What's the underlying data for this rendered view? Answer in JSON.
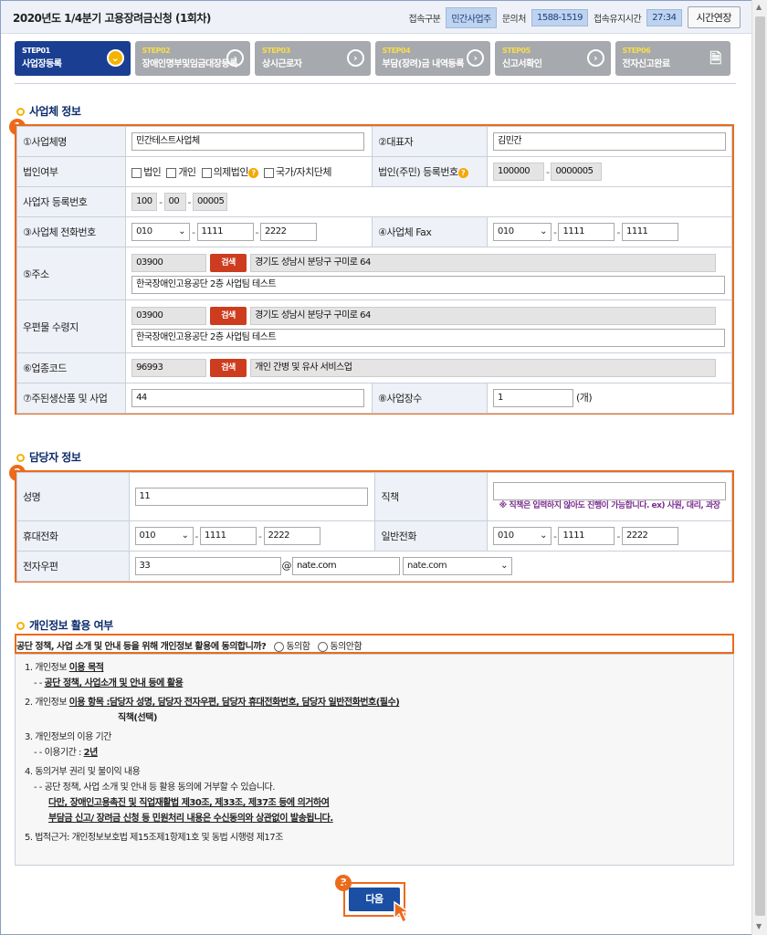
{
  "header": {
    "title": "2020년도 1/4분기 고용장려금신청 (1회차)",
    "conn_type_label": "접속구분",
    "conn_type_value": "민간사업주",
    "inquiry_label": "문의처",
    "inquiry_value": "1588-1519",
    "session_label": "접속유지시간",
    "session_value": "27:34",
    "extend_button": "시간연장"
  },
  "steps": [
    {
      "num": "STEP01",
      "label": "사업장등록",
      "active": true
    },
    {
      "num": "STEP02",
      "label": "장애인명부및임금대장등록",
      "active": false
    },
    {
      "num": "STEP03",
      "label": "상시근로자",
      "active": false
    },
    {
      "num": "STEP04",
      "label": "부담(장려)금 내역등록",
      "active": false
    },
    {
      "num": "STEP05",
      "label": "신고서확인",
      "active": false
    },
    {
      "num": "STEP06",
      "label": "전자신고완료",
      "active": false
    }
  ],
  "section1": {
    "title": "사업체 정보",
    "badge": "1",
    "company_name_label": "①사업체명",
    "company_name_value": "민간테스트사업체",
    "ceo_label": "②대표자",
    "ceo_value": "김민간",
    "corp_label": "법인여부",
    "corp_options": [
      "법인",
      "개인",
      "의제법인",
      "국가/자치단체"
    ],
    "corp_reg_label": "법인(주민) 등록번호",
    "corp_reg_1": "100000",
    "corp_reg_2": "0000005",
    "biz_no_label": "사업자 등록번호",
    "biz_no_1": "100",
    "biz_no_2": "00",
    "biz_no_3": "00005",
    "phone_label": "③사업체 전화번호",
    "phone_1": "010",
    "phone_2": "1111",
    "phone_3": "2222",
    "fax_label": "④사업체 Fax",
    "fax_1": "010",
    "fax_2": "1111",
    "fax_3": "1111",
    "addr_label": "⑤주소",
    "addr_zip": "03900",
    "addr_main": "경기도 성남시 분당구 구미로 64",
    "addr_detail": "한국장애인고용공단 2층 사업팀 테스트",
    "mail_addr_label": "우편물 수령지",
    "mail_zip": "03900",
    "mail_main": "경기도 성남시 분당구 구미로 64",
    "mail_detail": "한국장애인고용공단 2층 사업팀 테스트",
    "industry_label": "⑥업종코드",
    "industry_code": "96993",
    "industry_name": "개인 간병 및 유사 서비스업",
    "product_label": "⑦주된생산품 및 사업",
    "product_value": "44",
    "sites_label": "⑧사업장수",
    "sites_value": "1",
    "sites_unit": "(개)",
    "search_button": "검색"
  },
  "section2": {
    "title": "담당자 정보",
    "badge": "2",
    "name_label": "성명",
    "name_value": "11",
    "position_label": "직책",
    "position_value": "",
    "position_note": "※ 직책은 입력하지 않아도 진행이 가능합니다. ex) 사원, 대리, 과장",
    "mobile_label": "휴대전화",
    "mobile_1": "010",
    "mobile_2": "1111",
    "mobile_3": "2222",
    "tel_label": "일반전화",
    "tel_1": "010",
    "tel_2": "1111",
    "tel_3": "2222",
    "email_label": "전자우편",
    "email_id": "33",
    "email_at": "@",
    "email_domain": "nate.com",
    "email_domain_select": "nate.com"
  },
  "section3": {
    "title": "개인정보 활용 여부",
    "question": "공단 정책, 사업 소개 및 안내 등을 위해 개인정보 활용에 동의합니까?",
    "agree": "동의함",
    "disagree": "동의안함",
    "t1": "1. 개인정보 ",
    "t1u": "이용 목적",
    "t1a": "- - ",
    "t1au": "공단 정책, 사업소개 및 안내 등에 활용",
    "t2": "2. 개인정보 ",
    "t2u": "이용 항목 :담당자 성명, 담당자 전자우편, 담당자 휴대전화번호, 담당자 일반전화번호(필수)",
    "t2b": "직책(선택)",
    "t3": "3. 개인정보의 이용 기간",
    "t3a": "- - 이용기간 : ",
    "t3au": "2년",
    "t4": "4. 동의거부 권리 및 불이익 내용",
    "t4a": "- - 공단 정책, 사업 소개 및 안내 등 활용 동의에 거부할 수 있습니다.",
    "t4b": "다만, 장애인고용촉진 및 직업재활법 제30조, 제33조, 제37조 등에 의거하여",
    "t4c": "부담금 신고/ 장려금 신청 등 민원처리 내용은 수신동의와 상관없이 발송됩니다.",
    "t5": "5. 법적근거: 개인정보보호법 제15조제1항제1호 및 동법 시행령 제17조"
  },
  "footer": {
    "badge": "3",
    "next_button": "다음"
  }
}
